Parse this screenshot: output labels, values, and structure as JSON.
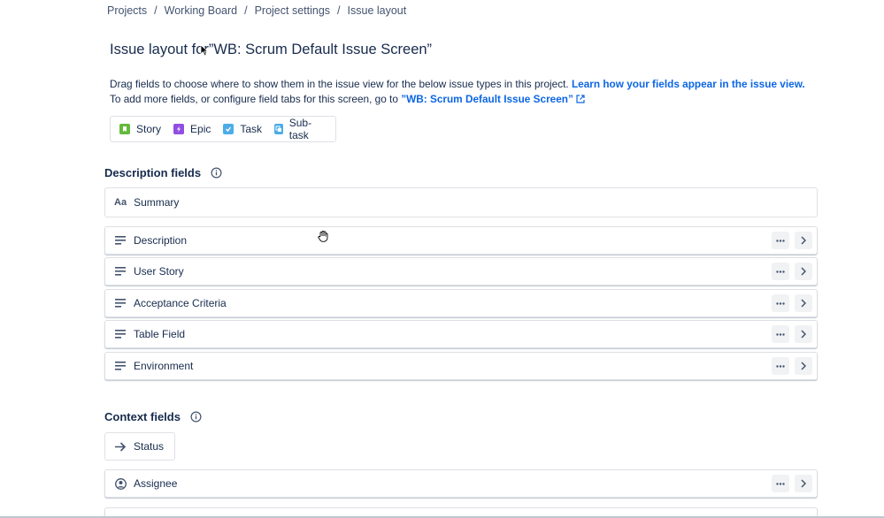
{
  "breadcrumb": {
    "items": [
      "Projects",
      "Working Board",
      "Project settings",
      "Issue layout"
    ],
    "separator": "/"
  },
  "page": {
    "title": "Issue layout for”WB: Scrum Default Issue Screen”",
    "description_text": "Drag fields to choose where to show them in the issue view for the below issue types in this project.",
    "description_link": "Learn how your fields appear in the issue view.",
    "config_text": "To add more fields, or configure field tabs for this screen, go to",
    "config_link": "”WB: Scrum Default Issue Screen”"
  },
  "issue_types": [
    {
      "label": "Story",
      "color": "#63ba3c",
      "icon": "story-icon"
    },
    {
      "label": "Epic",
      "color": "#904ee2",
      "icon": "epic-icon"
    },
    {
      "label": "Task",
      "color": "#4bade8",
      "icon": "task-icon"
    },
    {
      "label": "Sub-task",
      "color": "#4bade8",
      "icon": "subtask-icon"
    }
  ],
  "description_section": {
    "title": "Description fields",
    "summary_label": "Summary",
    "summary_icon": "Aa",
    "fields": [
      "Description",
      "User Story",
      "Acceptance Criteria",
      "Table Field",
      "Environment"
    ]
  },
  "context_section": {
    "title": "Context fields",
    "status_label": "Status",
    "fields": [
      "Assignee"
    ]
  },
  "colors": {
    "link": "#0c66e4",
    "text": "#172b4d",
    "border": "#dfe1e6",
    "action_bg": "#f1f2f4"
  }
}
